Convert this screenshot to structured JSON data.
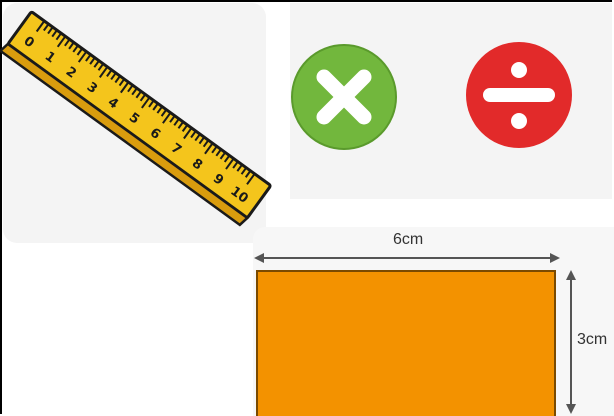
{
  "ruler": {
    "numbers": [
      "0",
      "1",
      "2",
      "3",
      "4",
      "5",
      "6",
      "7",
      "8",
      "9",
      "10"
    ],
    "colors": {
      "body": "#f4c51c",
      "edge": "#d99c0e",
      "outline": "#1a1a1a"
    }
  },
  "operations": [
    {
      "symbol": "multiply",
      "icon": "multiply-icon",
      "color": "#72b73d"
    },
    {
      "symbol": "divide",
      "icon": "divide-icon",
      "color": "#e22a2a"
    }
  ],
  "rectangle": {
    "width_label": "6cm",
    "height_label": "3cm",
    "fill_color": "#f39200"
  }
}
